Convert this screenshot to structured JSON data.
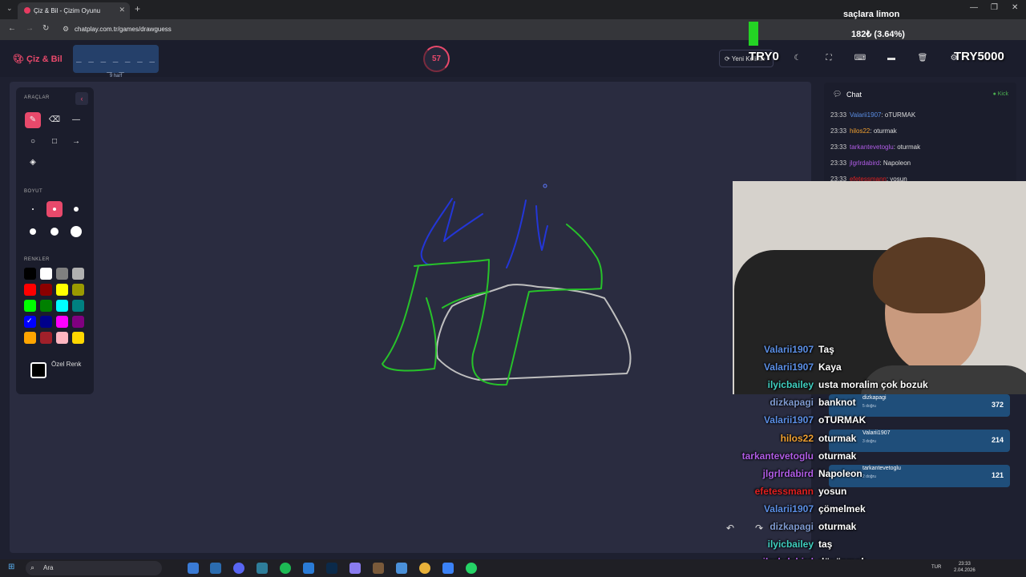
{
  "browser": {
    "tab_title": "Çiz & Bil - Çizim Oyunu",
    "url": "chatplay.com.tr/games/drawguess",
    "window_controls": [
      "—",
      "❐",
      "✕"
    ]
  },
  "header": {
    "brand": "Çiz & Bil",
    "word_mask": "_ _ _ _ _ _ _ _ _",
    "word_hint": "9 harf",
    "timer": "57",
    "new_round_label": "Yeni Kelime",
    "icons": [
      "moon-icon",
      "fullscreen-icon",
      "keyboard-icon",
      "layers-icon",
      "trash-icon",
      "settings-icon"
    ]
  },
  "tools": {
    "section_tools": "ARAÇLAR",
    "section_size": "BOYUT",
    "section_colors": "RENKLER",
    "custom_color_label": "Özel Renk",
    "colors": [
      "#000000",
      "#ffffff",
      "#808080",
      "#b0b0b0",
      "#ff0000",
      "#8b0000",
      "#ffff00",
      "#9a9a00",
      "#00ff00",
      "#008000",
      "#00ffff",
      "#008080",
      "#0000ff",
      "#00008b",
      "#ff00ff",
      "#800080",
      "#ffa500",
      "#a0202a",
      "#ffb6c1",
      "#ffd700"
    ],
    "selected_color_index": 12
  },
  "chat": {
    "title": "Chat",
    "source": "Kick",
    "messages": [
      {
        "time": "23:33",
        "user": "Valarii1907",
        "text": "oTURMAK",
        "color": "#5b8fe6"
      },
      {
        "time": "23:33",
        "user": "hilos22",
        "text": "oturmak",
        "color": "#f0a030"
      },
      {
        "time": "23:33",
        "user": "tarkantevetoglu",
        "text": "oturmak",
        "color": "#b05ce6"
      },
      {
        "time": "23:33",
        "user": "jlgrlrdabird",
        "text": "Napoleon",
        "color": "#b05ce6"
      },
      {
        "time": "23:33",
        "user": "efetessmann",
        "text": "yosun",
        "color": "#e02020"
      }
    ]
  },
  "overlay": {
    "donor": "saçlara limon",
    "amount": "182₺ (3.64%)",
    "goal_left": "TRY0",
    "goal_right": "TRY5000"
  },
  "scoreboard": [
    {
      "name": "dizkapagi",
      "sub": "5 doğru",
      "points": "372"
    },
    {
      "name": "Valarii1907",
      "sub": "3 doğru",
      "points": "214"
    },
    {
      "name": "tarkantevetoglu",
      "sub": "2 doğru",
      "points": "121"
    }
  ],
  "stream_chat": [
    {
      "user": "Valarii1907",
      "text": "Taş",
      "color": "#5b8fe6"
    },
    {
      "user": "Valarii1907",
      "text": "Kaya",
      "color": "#5b8fe6"
    },
    {
      "user": "ilyicbailey",
      "text": "usta moralim çok bozuk",
      "color": "#3fd0c0"
    },
    {
      "user": "dizkapagi",
      "text": "banknot",
      "color": "#7f9ad0"
    },
    {
      "user": "Valarii1907",
      "text": "oTURMAK",
      "color": "#5b8fe6"
    },
    {
      "user": "hilos22",
      "text": "oturmak",
      "color": "#f0a030"
    },
    {
      "user": "tarkantevetoglu",
      "text": "oturmak",
      "color": "#b05ce6"
    },
    {
      "user": "jlgrlrdabird",
      "text": "Napoleon",
      "color": "#b05ce6"
    },
    {
      "user": "efetessmann",
      "text": "yosun",
      "color": "#e02020"
    },
    {
      "user": "Valarii1907",
      "text": "çömelmek",
      "color": "#5b8fe6"
    },
    {
      "user": "dizkapagi",
      "text": "oturmak",
      "color": "#7f9ad0"
    },
    {
      "user": "ilyicbailey",
      "text": "taş",
      "color": "#3fd0c0"
    },
    {
      "user": "jlgrlrdabird",
      "text": "düşünmek",
      "color": "#b05ce6"
    }
  ],
  "taskbar": {
    "search_placeholder": "Ara",
    "lang": "TUR",
    "time": "23:33",
    "date": "2.04.2026"
  }
}
